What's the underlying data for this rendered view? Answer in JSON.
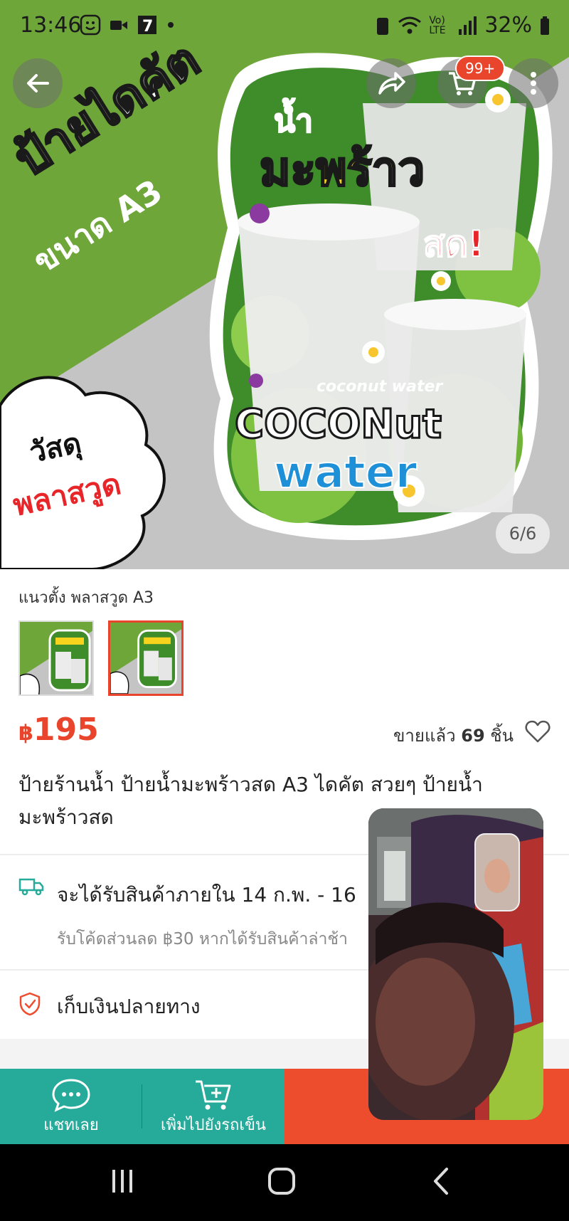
{
  "status_bar": {
    "time": "13:46",
    "battery": "32%",
    "network_label": "Vo) LTE"
  },
  "hero": {
    "counter": "6/6",
    "cart_badge": "99+",
    "poster_text": {
      "headline": "ป้ายไดคัต",
      "size": "ขนาด A3",
      "material_1": "วัสดุ",
      "material_2": "พลาสวูด",
      "drink_1": "น้ำ",
      "drink_2": "มะพร้าว",
      "drink_3": "สด!",
      "en_small": "coconut water",
      "en_1": "COCONut",
      "en_2": "water"
    }
  },
  "variants": {
    "label": "แนวตั้ง พลาสวูด  A3",
    "selected_index": 1
  },
  "product": {
    "currency": "฿",
    "price": "195",
    "sold_prefix": "ขายแล้ว",
    "sold_count": "69",
    "sold_suffix": "ชิ้น",
    "title": "ป้ายร้านน้ำ ป้ายน้ำมะพร้าวสด A3 ไดคัต สวยๆ ป้ายน้ำมะพร้าวสด"
  },
  "shipping": {
    "text": "จะได้รับสินค้าภายใน 14 ก.พ. - 16",
    "sub": "รับโค้ดส่วนลด ฿30 หากได้รับสินค้าล่าช้า"
  },
  "cod": {
    "text": "เก็บเงินปลายทาง"
  },
  "bottom_bar": {
    "chat_label": "แชทเลย",
    "add_cart_label": "เพิ่มไปยังรถเข็น"
  },
  "colors": {
    "accent": "#ee4d2d",
    "teal": "#26aa99",
    "hero_green": "#6ea63a"
  }
}
